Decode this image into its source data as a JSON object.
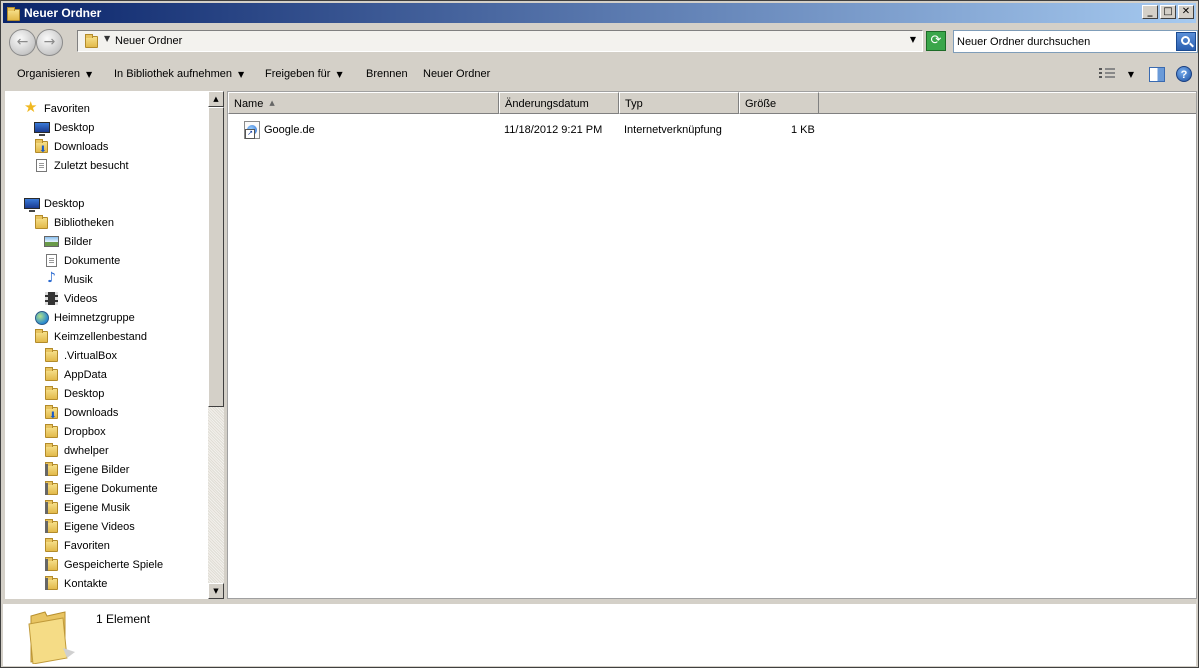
{
  "window": {
    "title": "Neuer Ordner"
  },
  "address": {
    "path": "Neuer Ordner",
    "search_placeholder": "Neuer Ordner durchsuchen"
  },
  "toolbar": {
    "organize": "Organisieren",
    "include_library": "In Bibliothek aufnehmen",
    "share": "Freigeben für",
    "burn": "Brennen",
    "new_folder": "Neuer Ordner"
  },
  "nav": {
    "favorites": [
      {
        "label": "Favoriten",
        "icon": "star-icon"
      },
      {
        "label": "Desktop",
        "icon": "desktop-icon"
      },
      {
        "label": "Downloads",
        "icon": "downloads-folder-icon"
      },
      {
        "label": "Zuletzt besucht",
        "icon": "recent-places-icon"
      }
    ],
    "tree": [
      {
        "label": "Desktop",
        "icon": "desktop-icon"
      },
      {
        "label": "Bibliotheken",
        "icon": "libraries-icon"
      },
      {
        "label": "Bilder",
        "icon": "pictures-icon"
      },
      {
        "label": "Dokumente",
        "icon": "documents-icon"
      },
      {
        "label": "Musik",
        "icon": "music-icon"
      },
      {
        "label": "Videos",
        "icon": "videos-icon"
      },
      {
        "label": "Heimnetzgruppe",
        "icon": "homegroup-icon"
      },
      {
        "label": "Keimzellenbestand",
        "icon": "user-folder-icon"
      },
      {
        "label": ".VirtualBox",
        "icon": "folder-icon"
      },
      {
        "label": "AppData",
        "icon": "folder-icon"
      },
      {
        "label": "Desktop",
        "icon": "desktop-folder-icon"
      },
      {
        "label": "Downloads",
        "icon": "downloads-folder-icon"
      },
      {
        "label": "Dropbox",
        "icon": "folder-icon"
      },
      {
        "label": "dwhelper",
        "icon": "folder-icon"
      },
      {
        "label": "Eigene Bilder",
        "icon": "pictures-folder-icon"
      },
      {
        "label": "Eigene Dokumente",
        "icon": "documents-folder-icon"
      },
      {
        "label": "Eigene Musik",
        "icon": "music-folder-icon"
      },
      {
        "label": "Eigene Videos",
        "icon": "videos-folder-icon"
      },
      {
        "label": "Favoriten",
        "icon": "favorites-folder-icon"
      },
      {
        "label": "Gespeicherte Spiele",
        "icon": "saved-games-folder-icon"
      },
      {
        "label": "Kontakte",
        "icon": "contacts-folder-icon"
      }
    ]
  },
  "columns": [
    "Name",
    "Änderungsdatum",
    "Typ",
    "Größe"
  ],
  "files": [
    {
      "name": "Google.de",
      "date": "11/18/2012 9:21 PM",
      "type": "Internetverknüpfung",
      "size": "1 KB",
      "icon": "internet-shortcut-icon"
    }
  ],
  "details": {
    "count": "1 Element"
  }
}
